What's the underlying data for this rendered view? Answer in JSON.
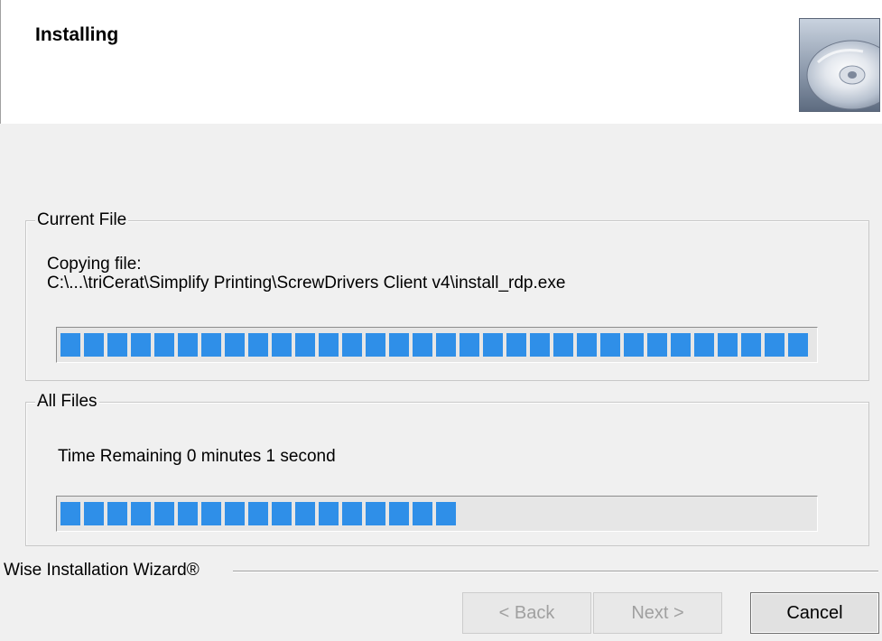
{
  "header": {
    "title": "Installing",
    "icon": "cd-disc-icon"
  },
  "current_file": {
    "legend": "Current File",
    "status_label": "Copying file:",
    "file_path": "C:\\...\\triCerat\\Simplify Printing\\ScrewDrivers Client v4\\install_rdp.exe",
    "progress": 1.0
  },
  "all_files": {
    "legend": "All Files",
    "time_remaining": "Time Remaining 0 minutes 1 second",
    "progress": 0.55
  },
  "footer": {
    "wizard_label": "Wise Installation Wizard®"
  },
  "buttons": {
    "back": "< Back",
    "next": "Next >",
    "cancel": "Cancel"
  },
  "colors": {
    "progress_fill": "#2f8fe8",
    "background": "#f0f0f0"
  }
}
